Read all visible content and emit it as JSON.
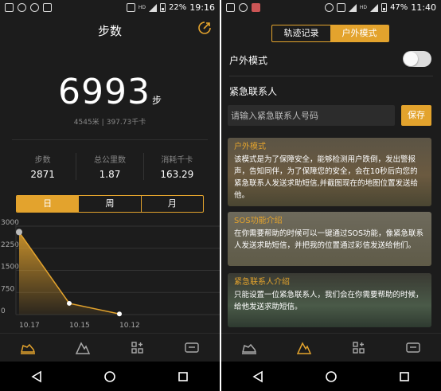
{
  "left": {
    "status": {
      "battery": "22%",
      "time": "19:16",
      "net": "HD"
    },
    "title": "步数",
    "steps": "6993",
    "steps_unit": "步",
    "meters": "4545米",
    "sub_sep": "|",
    "calories_kcal": "397.73千卡",
    "stats": [
      {
        "label": "步数",
        "value": "2871"
      },
      {
        "label": "总公里数",
        "value": "1.87"
      },
      {
        "label": "消耗千卡",
        "value": "163.29"
      }
    ],
    "tabs": [
      "日",
      "周",
      "月"
    ],
    "chart_data": {
      "type": "area",
      "x": [
        "10.17",
        "10.15",
        "10.12"
      ],
      "series": [
        {
          "values": [
            2800,
            380,
            20
          ]
        }
      ],
      "yticks": [
        "3000",
        "2250",
        "1500",
        "750",
        "0"
      ],
      "ylim": [
        0,
        3000
      ],
      "color": "#e3a32d",
      "grid": true
    }
  },
  "right": {
    "status": {
      "battery": "47%",
      "time": "11:40",
      "net": "HD"
    },
    "segments": [
      "轨迹记录",
      "户外模式"
    ],
    "outdoor_label": "户外模式",
    "emergency_label": "紧急联系人",
    "input_placeholder": "请输入紧急联系人号码",
    "save_label": "保存",
    "cards": [
      {
        "title": "户外模式",
        "text": "该模式是为了保障安全，能够检测用户跌倒，发出警报声，告知同伴，为了保障您的安全，会在10秒后向您的紧急联系人发送求助短信,并截图现在的地图位置发送给他。"
      },
      {
        "title": "SOS功能介绍",
        "text": "在你需要帮助的时候可以一键通过SOS功能，像紧急联系人发送求助短信，并把我的位置通过彩信发送给他们。"
      },
      {
        "title": "紧急联系人介绍",
        "text": "只能设置一位紧急联系人，我们会在你需要帮助的时候，给他发送求助短信。"
      }
    ]
  },
  "colors": {
    "accent": "#e3a32d",
    "bg": "#1c1c1c"
  }
}
